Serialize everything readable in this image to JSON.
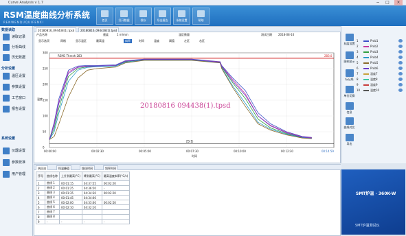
{
  "titlebar": {
    "app": "Curve Analysis v 1.7",
    "min": "−",
    "max": "□",
    "close": "×"
  },
  "logo": {
    "main": "RSM温度曲线分析系统",
    "sub": "RENWENQUQUIFENXI"
  },
  "toolbar": [
    {
      "id": "home",
      "label": "首页"
    },
    {
      "id": "open",
      "label": "打开数据"
    },
    {
      "id": "save",
      "label": "保存"
    },
    {
      "id": "export",
      "label": "导出报告"
    },
    {
      "id": "sys",
      "label": "系统设置"
    },
    {
      "id": "help",
      "label": "帮助"
    }
  ],
  "sidebar": {
    "groups": [
      {
        "label": "数据读取",
        "items": [
          "读取记录",
          "分析曲线",
          "历史数据"
        ]
      },
      {
        "label": "分析设置",
        "items": [
          "温区设置",
          "参数设置",
          "工艺窗口",
          "报告设置"
        ]
      },
      {
        "label": "系统设置",
        "items": [
          "仪器设置",
          "参数校准",
          "用户管理"
        ]
      }
    ]
  },
  "file_tabs": [
    "20180816_094438(1).tpsd",
    "20180816_094438(1).tpsd"
  ],
  "info": {
    "product_label": "产品名称",
    "product_val": "",
    "speed_label": "速度",
    "speed_val": "1 m/min",
    "zone_label": "温区数量",
    "zone_val": "",
    "date_label": "测试日期",
    "date_val": "2018-08-16"
  },
  "controls": [
    "显示选项",
    "网格",
    "显示温区",
    "最高温",
    "斜率",
    "时间",
    "温度",
    "阈值",
    "左区",
    "右区"
  ],
  "watermark": "20180816 094438(1).tpsd",
  "chart_data": {
    "type": "line",
    "title": "",
    "xlabel": "时间",
    "ylabel": "温度",
    "ylim": [
      0,
      300
    ],
    "xlim": [
      0,
      900
    ],
    "x_ticks": [
      "00:00:00",
      "00:02:30",
      "00:05:00",
      "00:07:30",
      "00:10:00",
      "00:12:30"
    ],
    "x_tick_vals": [
      0,
      150,
      300,
      450,
      600,
      750
    ],
    "threshold_label": "RSM1 Thresh 283",
    "threshold_right": "283.0",
    "threshold": 283,
    "baseline_label": "25(1)",
    "bottom_label": "00:14:59",
    "series": [
      {
        "name": "Prob1",
        "color": "#3b4fc8",
        "x": [
          0,
          15,
          30,
          60,
          90,
          120,
          150,
          210,
          240,
          300,
          450,
          540,
          545,
          580,
          620,
          660,
          700,
          750,
          800,
          830
        ],
        "values": [
          25,
          80,
          155,
          245,
          258,
          260,
          260,
          262,
          275,
          280,
          280,
          272,
          260,
          220,
          180,
          110,
          75,
          50,
          35,
          32
        ]
      },
      {
        "name": "Prob2",
        "color": "#c83b9e",
        "x": [
          0,
          15,
          30,
          60,
          90,
          120,
          150,
          210,
          240,
          300,
          450,
          540,
          545,
          580,
          620,
          660,
          700,
          750,
          800,
          830
        ],
        "values": [
          25,
          75,
          145,
          240,
          255,
          258,
          258,
          260,
          274,
          279,
          279,
          271,
          258,
          215,
          170,
          100,
          70,
          48,
          34,
          31
        ]
      },
      {
        "name": "Prob3",
        "color": "#2f9f3f",
        "x": [
          0,
          15,
          30,
          60,
          90,
          120,
          150,
          210,
          240,
          300,
          450,
          540,
          545,
          580,
          620,
          660,
          700,
          750,
          800,
          830
        ],
        "values": [
          25,
          60,
          125,
          225,
          250,
          256,
          257,
          259,
          272,
          278,
          278,
          270,
          255,
          205,
          155,
          90,
          62,
          44,
          32,
          30
        ]
      },
      {
        "name": "Prob4",
        "color": "#2a9ac8",
        "x": [
          0,
          15,
          30,
          60,
          90,
          120,
          150,
          210,
          240,
          300,
          450,
          540,
          545,
          580,
          620,
          660,
          700,
          750,
          800,
          830
        ],
        "values": [
          25,
          50,
          110,
          210,
          245,
          254,
          256,
          258,
          270,
          277,
          277,
          269,
          252,
          195,
          140,
          80,
          58,
          42,
          31,
          29
        ]
      },
      {
        "name": "Prob5",
        "color": "#8a6a2a",
        "x": [
          0,
          15,
          30,
          60,
          90,
          120,
          150,
          210,
          240,
          300,
          450,
          540,
          545,
          580,
          620,
          660,
          700,
          750,
          800,
          830
        ],
        "values": [
          25,
          35,
          75,
          160,
          220,
          245,
          250,
          255,
          268,
          276,
          276,
          268,
          250,
          190,
          130,
          75,
          55,
          40,
          30,
          28
        ]
      },
      {
        "name": "Prob6",
        "color": "#6a3bc8",
        "x": [
          0,
          15,
          30,
          60,
          90,
          120,
          150,
          210,
          240,
          300,
          450,
          540,
          545,
          580,
          620,
          660,
          700,
          750,
          800,
          830
        ],
        "values": [
          25,
          70,
          140,
          235,
          254,
          257,
          258,
          260,
          273,
          279,
          279,
          270,
          257,
          210,
          165,
          100,
          68,
          46,
          33,
          30
        ]
      }
    ]
  },
  "right_buttons": [
    "刻度设置",
    "图例显示",
    "标记线",
    "单位切换",
    "信息",
    "曲线对比",
    "导出"
  ],
  "legend_header": [
    "序号",
    "曲线",
    "名称"
  ],
  "legend_rows": [
    {
      "num": "1",
      "name": "Prob1",
      "color": "#3b4fc8"
    },
    {
      "num": "2",
      "name": "Prob2",
      "color": "#c83b9e"
    },
    {
      "num": "3",
      "name": "Prob3",
      "color": "#2f9f3f"
    },
    {
      "num": "4",
      "name": "Prob4",
      "color": "#2a9ac8"
    },
    {
      "num": "5",
      "name": "Prob5",
      "color": "#8a6a2a"
    },
    {
      "num": "6",
      "name": "Prob6",
      "color": "#6a3bc8"
    },
    {
      "num": "7",
      "name": "温度7",
      "color": "#c8a03b"
    },
    {
      "num": "8",
      "name": "温度8",
      "color": "#3bc8a0"
    },
    {
      "num": "9",
      "name": "温度9",
      "color": "#c83b3b"
    },
    {
      "num": "10",
      "name": "温度10",
      "color": "#555555"
    }
  ],
  "bottom_tabs": [
    "热回流",
    "恒温峰值",
    "熔化时间",
    "斜率时间"
  ],
  "table": {
    "headers": [
      "序号",
      "曲线名称",
      "上升到最高(°C)",
      "降到最高(°C)",
      "最高温度斜率(°C/s)"
    ],
    "rows": [
      [
        "1",
        "曲线 1",
        "00:01:15",
        "04:37:55",
        "00:02:20"
      ],
      [
        "2",
        "曲线 2",
        "00:01:25",
        "04:36:50",
        "-"
      ],
      [
        "3",
        "曲线 3",
        "00:01:35",
        "04:34:30",
        "00:02:20"
      ],
      [
        "4",
        "曲线 4",
        "00:01:45",
        "04:34:00",
        ""
      ],
      [
        "5",
        "曲线 5",
        "00:02:00",
        "04:33:00",
        "00:02:50"
      ],
      [
        "6",
        "曲线 6",
        "00:02:10",
        "04:32:10",
        ""
      ],
      [
        "7",
        "曲线 7",
        "",
        "",
        ""
      ],
      [
        "8",
        "曲线 8",
        "",
        "",
        ""
      ],
      [
        "9",
        "-",
        "-",
        "-",
        "-"
      ]
    ]
  },
  "ad": {
    "model": "SMT炉温 · 360K-W",
    "line": "SMT炉温测试仪"
  }
}
